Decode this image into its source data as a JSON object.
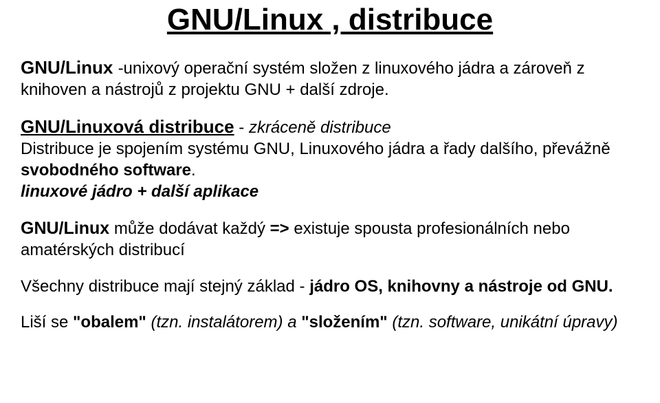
{
  "title": "GNU/Linux , distribuce",
  "p1": {
    "lead": "GNU/Linux ",
    "rest": "-unixový operační systém složen z linuxového jádra a zároveň z knihoven a nástrojů z projektu GNU + další zdroje."
  },
  "p2": {
    "lead": "GNU/Linuxová distribuce",
    "dash": " - ",
    "italic": " zkráceně distribuce",
    "line2a": "Distribuce je spojením systému GNU, Linuxového jádra a řady dalšího, převážně ",
    "line2b": "svobodného software",
    "line2c": ".",
    "line3": "linuxové jádro + další aplikace"
  },
  "p3": {
    "lead": "GNU/Linux",
    "mid": " může dodávat každý ",
    "arrow": " => ",
    "rest": "existuje spousta profesionálních nebo amatérských distribucí"
  },
  "p4": {
    "a": "Všechny distribuce mají stejný základ - ",
    "b": "jádro OS, knihovny a nástroje od GNU."
  },
  "p5": {
    "a": "Liší se ",
    "b": "\"obalem\"",
    "c": " (tzn. instalátorem) a ",
    "d": "\"složením\"",
    "e": " (tzn. software, unikátní úpravy)"
  }
}
